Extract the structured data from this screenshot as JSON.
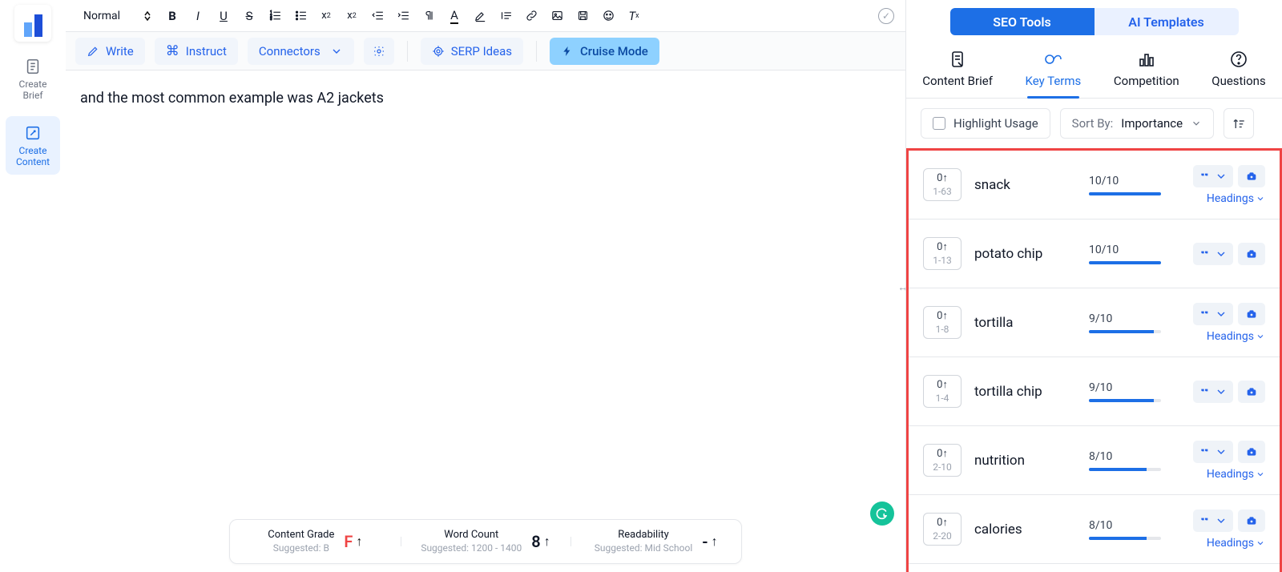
{
  "leftRail": {
    "createBrief": "Create Brief",
    "createContent": "Create Content"
  },
  "formatBar": {
    "style": "Normal"
  },
  "actionBar": {
    "write": "Write",
    "instruct": "Instruct",
    "connectors": "Connectors",
    "serp": "SERP Ideas",
    "cruise": "Cruise Mode"
  },
  "editor": {
    "text": "and the most common example was A2 jackets"
  },
  "stats": {
    "grade": {
      "title": "Content Grade",
      "sub": "Suggested: B",
      "value": "F"
    },
    "words": {
      "title": "Word Count",
      "sub": "Suggested: 1200 - 1400",
      "value": "8"
    },
    "read": {
      "title": "Readability",
      "sub": "Suggested: Mid School",
      "value": "-"
    }
  },
  "rightPanel": {
    "seg": {
      "seo": "SEO Tools",
      "ai": "AI Templates"
    },
    "tabs": {
      "brief": "Content Brief",
      "terms": "Key Terms",
      "comp": "Competition",
      "q": "Questions"
    },
    "filter": {
      "highlight": "Highlight Usage",
      "sortLabel": "Sort By:",
      "sortValue": "Importance"
    },
    "headings": "Headings",
    "terms": [
      {
        "count": "0↑",
        "range": "1-63",
        "name": "snack",
        "score": "10/10",
        "pct": 100,
        "showHeadings": true
      },
      {
        "count": "0↑",
        "range": "1-13",
        "name": "potato chip",
        "score": "10/10",
        "pct": 100,
        "showHeadings": false
      },
      {
        "count": "0↑",
        "range": "1-8",
        "name": "tortilla",
        "score": "9/10",
        "pct": 90,
        "showHeadings": true
      },
      {
        "count": "0↑",
        "range": "1-4",
        "name": "tortilla chip",
        "score": "9/10",
        "pct": 90,
        "showHeadings": false
      },
      {
        "count": "0↑",
        "range": "2-10",
        "name": "nutrition",
        "score": "8/10",
        "pct": 80,
        "showHeadings": true
      },
      {
        "count": "0↑",
        "range": "2-20",
        "name": "calories",
        "score": "8/10",
        "pct": 80,
        "showHeadings": true
      }
    ]
  }
}
